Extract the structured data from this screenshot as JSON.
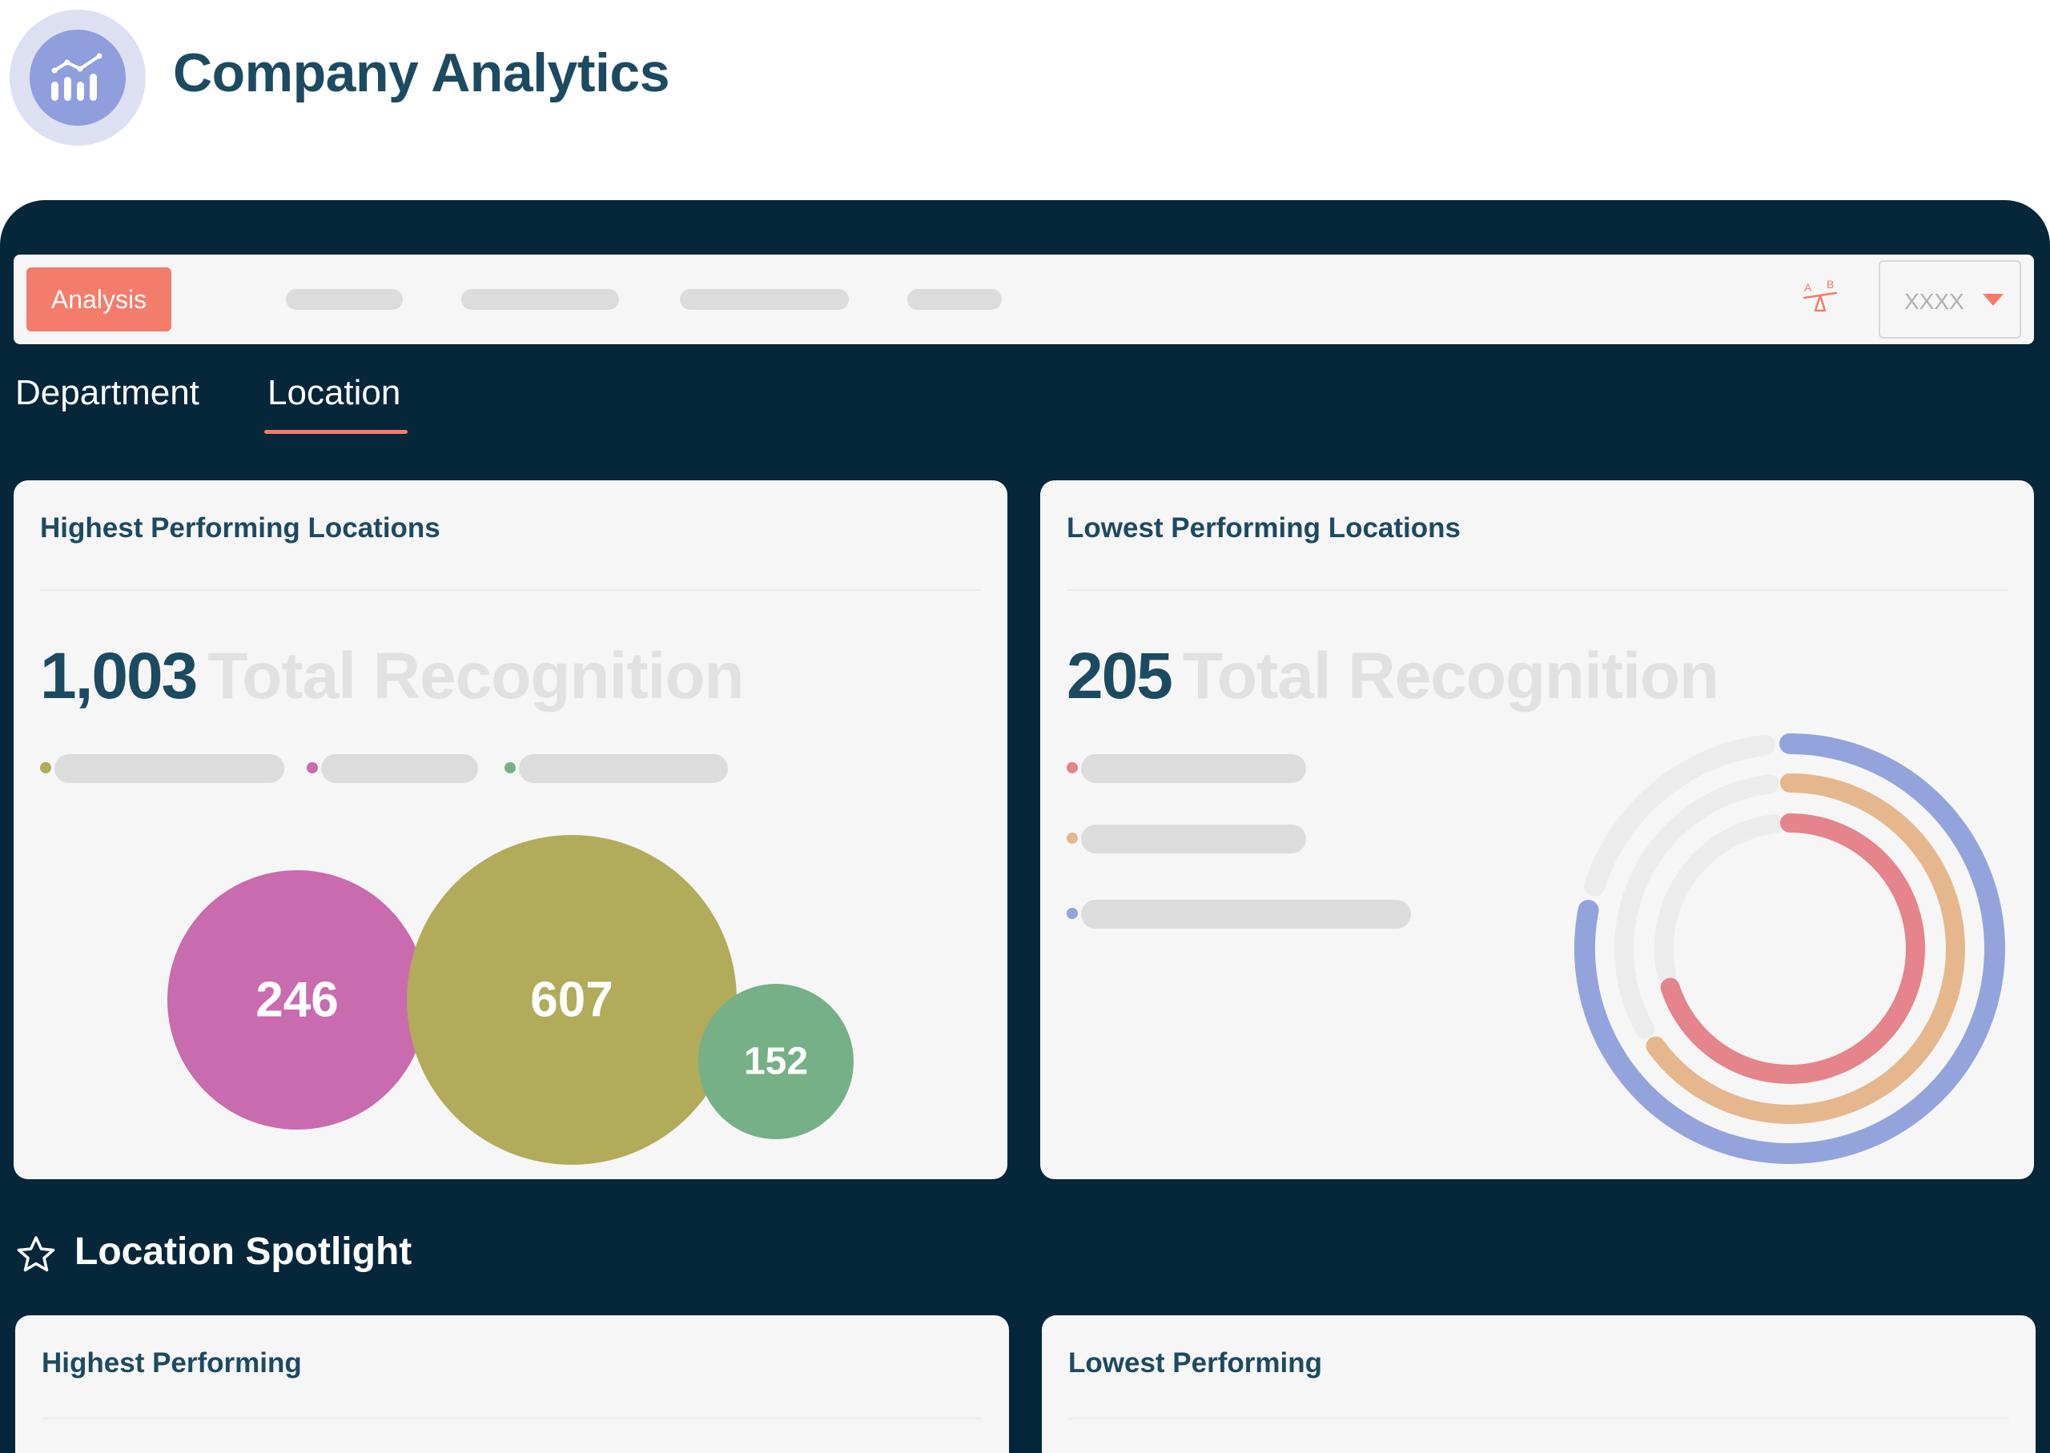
{
  "app": {
    "title": "Company Analytics",
    "logo_icon": "bar-chart-icon"
  },
  "toolbar": {
    "analysis_label": "Analysis",
    "ab_icon": "ab-test-icon",
    "dropdown_value": "XXXX",
    "accent_color": "#f47c6a"
  },
  "tabs": [
    {
      "label": "Department",
      "active": false
    },
    {
      "label": "Location",
      "active": true
    }
  ],
  "highest_card": {
    "title": "Highest Performing Locations",
    "total": "1,003",
    "total_label": "Total Recognition",
    "bubbles": [
      {
        "value": 246,
        "color": "#c96baf"
      },
      {
        "value": 607,
        "color": "#b1ab5a"
      },
      {
        "value": 152,
        "color": "#76b086"
      }
    ]
  },
  "lowest_card": {
    "title": "Lowest Performing Locations",
    "total": "205",
    "total_label": "Total Recognition",
    "ring_colors": [
      "#e5848a",
      "#e6b78d",
      "#93a4dc"
    ],
    "ring_fractions": [
      0.7,
      0.65,
      0.78
    ]
  },
  "spotlight": {
    "icon": "star-icon",
    "title": "Location Spotlight",
    "highest_title": "Highest Performing",
    "lowest_title": "Lowest Performing"
  }
}
